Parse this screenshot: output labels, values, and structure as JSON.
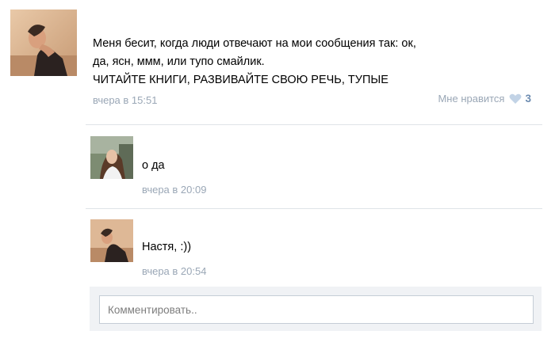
{
  "post": {
    "text_lines": [
      "Меня бесит, когда люди отвечают на мои сообщения так: ок,",
      "да, ясн, ммм, или тупо смайлик.",
      "ЧИТАЙТЕ КНИГИ, РАЗВИВАЙТЕ СВОЮ РЕЧЬ, ТУПЫЕ"
    ],
    "timestamp": "вчера в 15:51",
    "like_label": "Мне нравится",
    "like_count": "3",
    "avatar_icon": "user-photo-avatar"
  },
  "comments": [
    {
      "text": "о да",
      "timestamp": "вчера в 20:09",
      "avatar_icon": "user-photo-avatar"
    },
    {
      "text": "Настя, :))",
      "timestamp": "вчера в 20:54",
      "avatar_icon": "user-photo-avatar"
    }
  ],
  "comment_box": {
    "placeholder": "Комментировать.."
  },
  "colors": {
    "meta_text": "#9aa7b6",
    "like_count": "#6c8bb0",
    "divider": "#dfe3e8",
    "comment_area_bg": "#f0f2f5"
  }
}
